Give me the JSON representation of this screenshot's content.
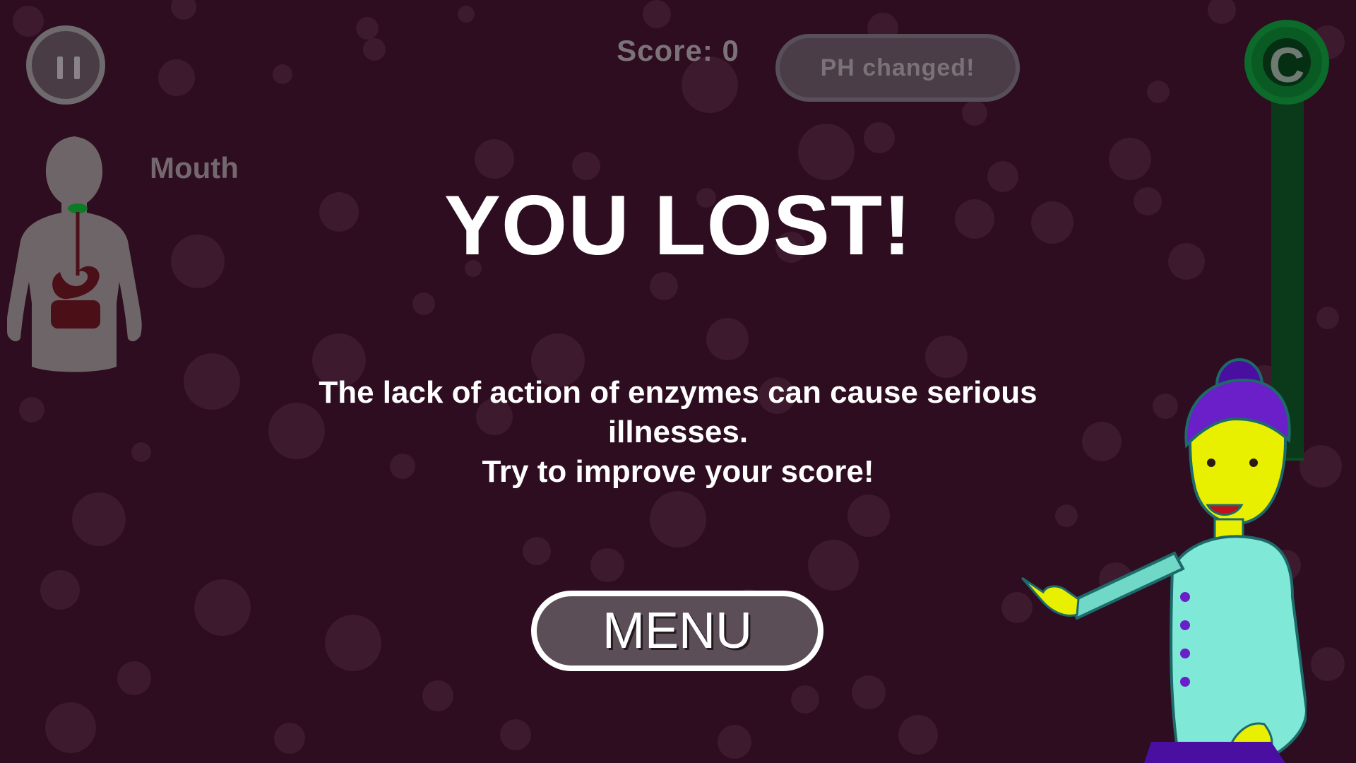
{
  "hud": {
    "score_text": "Score: 0",
    "notification": "PH changed!",
    "organ_label": "Mouth",
    "ph_meter_letter": "C"
  },
  "result": {
    "title": "YOU LOST!",
    "message_line1": "The lack of action of enzymes can cause serious",
    "message_line2": "illnesses.",
    "message_line3": "Try to improve your score!"
  },
  "buttons": {
    "menu_label": "MENU"
  },
  "icons": {
    "pause": "pause-icon",
    "body": "digestive-system-body-icon",
    "teacher": "teacher-character"
  },
  "colors": {
    "background": "#2d0d1f",
    "meter_green": "#0a5a23",
    "text": "#ffffff"
  }
}
